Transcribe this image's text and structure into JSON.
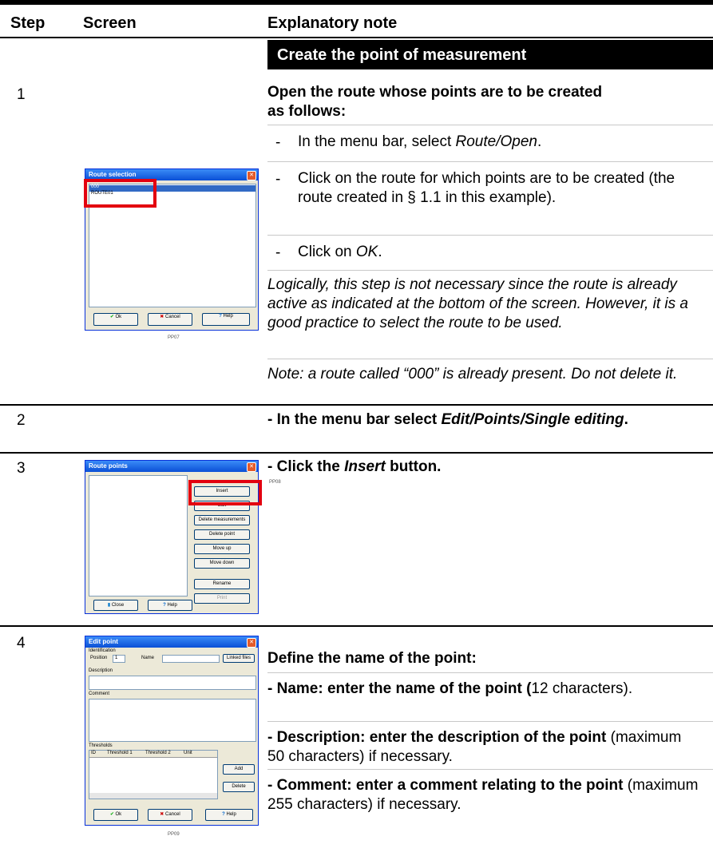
{
  "header": {
    "step": "Step",
    "screen": "Screen",
    "note": "Explanatory note"
  },
  "section_title": "Create the point of measurement",
  "steps": [
    {
      "number": "1",
      "heading": "Open the route whose points are to be created as follows:",
      "items": [
        {
          "pre": "In the menu bar, select ",
          "em": "Route/Open",
          "post": "."
        },
        {
          "pre": "Click on the route for which points are to be created (the route created in § 1.1 in this example).",
          "em": "",
          "post": ""
        },
        {
          "pre": "Click on ",
          "em": "OK",
          "post": "."
        }
      ],
      "italic_note": "Logically, this step is not necessary since the route is already active as indicated at the bottom of the screen. However, it is a good practice to select the route to be used.",
      "italic_note2": "Note: a route called “000” is already present. Do not delete it.",
      "caption": "PP07",
      "dialog": {
        "title": "Route selection",
        "list": [
          "000",
          "ROUTE01"
        ],
        "ok": "Ok",
        "cancel": "Cancel",
        "help": "Help"
      }
    },
    {
      "number": "2",
      "text_pre": "- In the menu bar select ",
      "text_em": "Edit/Points/Single editing",
      "text_post": "."
    },
    {
      "number": "3",
      "text_pre": "- Click the ",
      "text_em": "Insert",
      "text_post": " button.",
      "caption": "PP08",
      "dialog": {
        "title": "Route points",
        "buttons": [
          "Insert",
          "Edit",
          "Delete measurements",
          "Delete point",
          "Move up",
          "Move down",
          "Rename",
          "Print"
        ],
        "close": "Close",
        "help": "Help"
      }
    },
    {
      "number": "4",
      "heading": "Define the name of the point:",
      "items": [
        {
          "bold": "- Name: enter the name of the point (",
          "normal": "12 characters)."
        },
        {
          "bold": "- Description: enter the description of the point",
          "normal": " (maximum 50 characters) if necessary."
        },
        {
          "bold": "- Comment: enter a comment relating to the point",
          "normal": " (maximum 255 characters) if necessary."
        }
      ],
      "caption": "PP09",
      "dialog": {
        "title": "Edit point",
        "identification": "Identification",
        "position": "Position",
        "position_value": "1",
        "name": "Name",
        "linked_files": "Linked files",
        "description": "Description",
        "comment": "Comment",
        "thresholds": "Thresholds",
        "cols": [
          "ID",
          "Threshold 1",
          "Threshold 2",
          "Unit"
        ],
        "add": "Add",
        "delete": "Delete",
        "ok": "Ok",
        "cancel": "Cancel",
        "help": "Help"
      }
    }
  ],
  "colors": {
    "highlight": "#e3000f",
    "bar": "#000000",
    "xp_title": "#0a4fd6"
  }
}
